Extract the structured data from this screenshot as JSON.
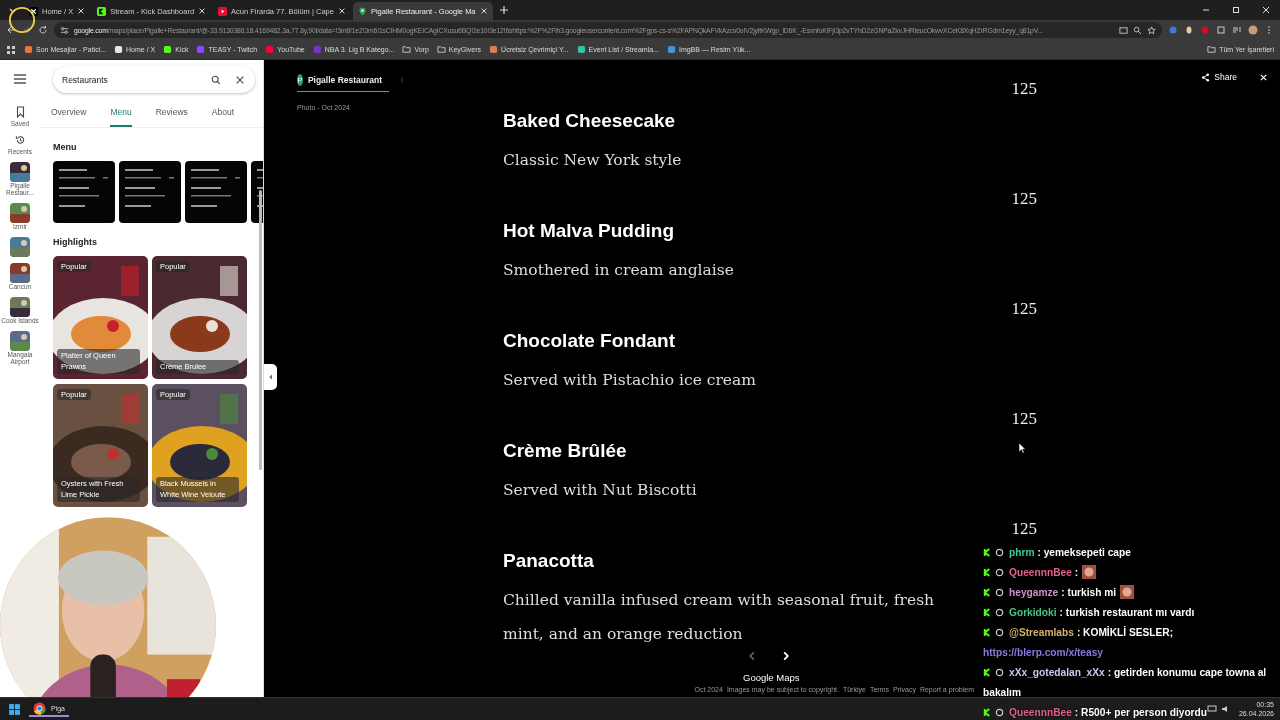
{
  "browser": {
    "tabs": [
      {
        "title": "Home / X",
        "kind": "x",
        "selected": false
      },
      {
        "title": "Stream - Kick Dashboard",
        "kind": "kick",
        "selected": false
      },
      {
        "title": "Acun Firarda 77. Bölüm | Cape",
        "kind": "video",
        "selected": false
      },
      {
        "title": "Pigalle Restaurant - Google Ma",
        "kind": "pin",
        "selected": true
      }
    ],
    "url_host": "google.com",
    "url_path": "/maps/place/Pigalle+Restaurant/@-33.9130386,18.4169482,3a,77.8y,90t/data=!3m8!1e2!3m6!1sCIHM0ogKEICAgICXusu6BQ!2e10!3e12!6shttps:%2F%2Flh3.googleusercontent.com%2Fgps-cs-s%2FAPNQkAFVkAzcv0oIV2jyltKWgp_lD6K_-EsxnfoKIFjI3p2vTYhD2zGNPaZkvJHRteucOkwvXCeK8XqHZrRGdm1eyy_q81pV...",
    "bookmarks": [
      {
        "label": "Son Mesajlar - Patici...",
        "kind": "site",
        "color": "#e8743b"
      },
      {
        "label": "Home / X",
        "kind": "site",
        "color": "#e6e6e6"
      },
      {
        "label": "Kick",
        "kind": "site",
        "color": "#53fc18"
      },
      {
        "label": "TEASY - Twitch",
        "kind": "site",
        "color": "#9146ff"
      },
      {
        "label": "YouTube",
        "kind": "site",
        "color": "#ff0033"
      },
      {
        "label": "NBA 3. Lig B Katego...",
        "kind": "site",
        "color": "#7a2fd0"
      },
      {
        "label": "Vorp",
        "kind": "folder"
      },
      {
        "label": "KeyGivers",
        "kind": "folder"
      },
      {
        "label": "Ücretsiz Çevrimiçi Y...",
        "kind": "site",
        "color": "#e07a5f"
      },
      {
        "label": "Event List / Streamla...",
        "kind": "site",
        "color": "#31c3a2"
      },
      {
        "label": "ImgBB — Resim Yük...",
        "kind": "site",
        "color": "#4a90d9"
      }
    ],
    "all_bookmarks": "Tüm Yer İşaretleri"
  },
  "maps": {
    "rail": [
      {
        "kind": "menu"
      },
      {
        "kind": "saved",
        "label": "Saved"
      },
      {
        "kind": "recents",
        "label": "Recents"
      },
      {
        "kind": "place",
        "label": "Pigalle Restaur..."
      },
      {
        "kind": "place",
        "label": "İzmir"
      },
      {
        "kind": "place"
      },
      {
        "kind": "place",
        "label": "Cancún"
      },
      {
        "kind": "place",
        "label": "Cook Islands"
      },
      {
        "kind": "place",
        "label": "Mangaia Airport"
      }
    ],
    "search": {
      "value": "Restaurants"
    },
    "tabs": [
      {
        "label": "Overview",
        "selected": false
      },
      {
        "label": "Menu",
        "selected": true
      },
      {
        "label": "Reviews",
        "selected": false
      },
      {
        "label": "About",
        "selected": false
      }
    ],
    "menu_heading": "Menu",
    "highlights_heading": "Highlights",
    "highlights": [
      {
        "badge": "Popular",
        "caption": "Platter of Queen Prawns"
      },
      {
        "badge": "Popular",
        "caption": "Crème Brulee"
      },
      {
        "badge": "Popular",
        "caption": "Oysters with Fresh Lime Pickle"
      },
      {
        "badge": "Popular",
        "caption": "Black Mussels in White Wine Veloute"
      }
    ]
  },
  "viewer": {
    "avatar": "P",
    "author": "Pigalle Restaurant",
    "date": "Photo - Oct 2024",
    "share": "Share",
    "items": [
      {
        "price": "125",
        "name": "Baked Cheesecake",
        "description": "Classic New York style"
      },
      {
        "price": "125",
        "name": "Hot Malva Pudding",
        "description": "Smothered in cream anglaise"
      },
      {
        "price": "125",
        "name": "Chocolate Fondant",
        "description": "Served with Pistachio ice cream"
      },
      {
        "price": "125",
        "name": "Crème Brûlée",
        "description": "Served with Nut Biscotti"
      },
      {
        "price": "125",
        "name": "Panacotta",
        "description": "Chilled vanilla infused cream with seasonal fruit, fresh mint, and an orange reduction"
      }
    ],
    "brand": "Google Maps",
    "footer": [
      "Oct 2024",
      "Images may be subject to copyright.",
      "Türkiye",
      "Terms",
      "Privacy",
      "Report a problem"
    ]
  },
  "chat": [
    {
      "user": "phrm",
      "color": "#3fc79a",
      "text": ": yemeksepeti cape",
      "emote": false
    },
    {
      "user": "QueennnBee",
      "color": "#e0608f",
      "text": ":",
      "emote": true
    },
    {
      "user": "heygamze",
      "color": "#d58fd0",
      "text": ": turkish mi",
      "emote": true
    },
    {
      "user": "Gorkidoki",
      "color": "#46c48a",
      "text": ": turkish restaurant mı vardı",
      "emote": false
    },
    {
      "user": "@Streamlabs",
      "color": "#d9b36c",
      "text": ": KOMİKLİ SESLER;",
      "link": "https://blerp.com/x/teasy",
      "emote": false
    },
    {
      "user": "xXx_gotedalan_xXx",
      "color": "#c9c9f0",
      "text": ": getirden konumu cape towna al bakalım",
      "emote": false
    },
    {
      "user": "QueennnBee",
      "color": "#e0608f",
      "text": ": R500+ per person diyordu",
      "emote": false
    }
  ],
  "taskbar": {
    "app": "Piga",
    "time": "00:35",
    "date": "26.04.2026"
  }
}
